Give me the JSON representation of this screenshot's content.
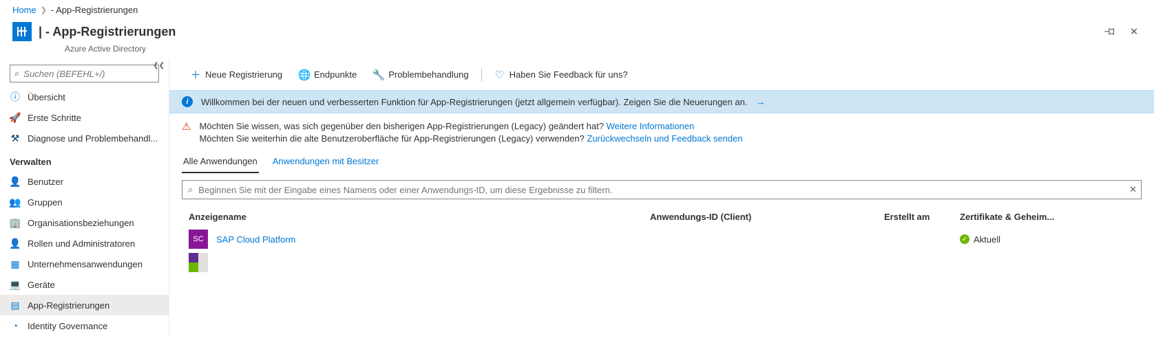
{
  "breadcrumb": {
    "home": "Home",
    "current": "- App-Registrierungen"
  },
  "header": {
    "title": "| - App-Registrierungen",
    "subtitle": "Azure Active Directory"
  },
  "sidebar": {
    "search_placeholder": "Suchen (BEFEHL+/)",
    "items_top": [
      {
        "label": "Übersicht"
      },
      {
        "label": "Erste Schritte"
      },
      {
        "label": "Diagnose und Problembehandl..."
      }
    ],
    "section_heading": "Verwalten",
    "items_manage": [
      {
        "label": "Benutzer"
      },
      {
        "label": "Gruppen"
      },
      {
        "label": "Organisationsbeziehungen"
      },
      {
        "label": "Rollen und Administratoren"
      },
      {
        "label": "Unternehmensanwendungen"
      },
      {
        "label": "Geräte"
      },
      {
        "label": "App-Registrierungen"
      },
      {
        "label": "Identity Governance"
      }
    ]
  },
  "commands": {
    "new": "Neue Registrierung",
    "endpoints": "Endpunkte",
    "troubleshoot": "Problembehandlung",
    "feedback": "Haben Sie Feedback für uns?"
  },
  "info_banner": "Willkommen bei der neuen und verbesserten Funktion für App-Registrierungen (jetzt allgemein verfügbar). Zeigen Sie die Neuerungen an.",
  "warn_banner": {
    "line1_prefix": "Möchten Sie wissen, was sich gegenüber den bisherigen App-Registrierungen (Legacy) geändert hat? ",
    "line1_link": "Weitere Informationen",
    "line2_prefix": "Möchten Sie weiterhin die alte Benutzeroberfläche für App-Registrierungen (Legacy) verwenden? ",
    "line2_link": "Zurückwechseln und Feedback senden"
  },
  "tabs": {
    "all": "Alle Anwendungen",
    "owned": "Anwendungen mit Besitzer"
  },
  "filter_placeholder": "Beginnen Sie mit der Eingabe eines Namens oder einer Anwendungs-ID, um diese Ergebnisse zu filtern.",
  "table": {
    "headers": {
      "name": "Anzeigename",
      "appid": "Anwendungs-ID (Client)",
      "created": "Erstellt am",
      "cert": "Zertifikate & Geheim..."
    },
    "rows": [
      {
        "avatar": "SC",
        "name": "SAP Cloud Platform",
        "appid": "",
        "created": "",
        "cert": "Aktuell"
      },
      {
        "avatar": "",
        "name": "",
        "appid": "",
        "created": "",
        "cert": ""
      }
    ]
  }
}
